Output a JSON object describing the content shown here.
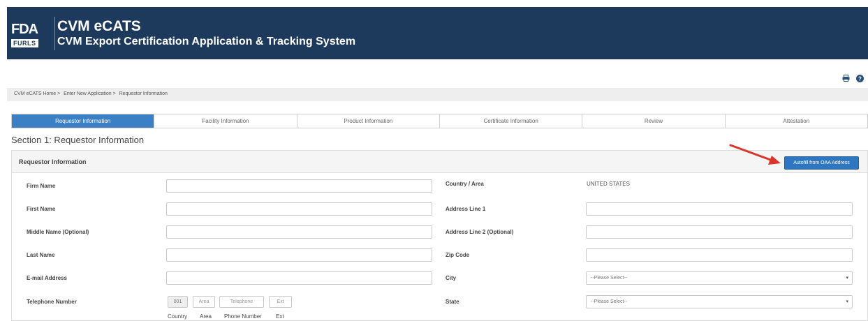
{
  "header": {
    "logo_top": "FDA",
    "logo_bottom": "FURLS",
    "title": "CVM eCATS",
    "subtitle": "CVM Export Certification Application & Tracking System"
  },
  "tools": {
    "print_icon": "print-icon",
    "help_icon": "help-icon"
  },
  "breadcrumb": [
    "CVM eCATS Home >",
    "Enter New Application >",
    "Requestor Information"
  ],
  "tabs": [
    {
      "label": "Requestor Information",
      "active": true
    },
    {
      "label": "Facility Information",
      "active": false
    },
    {
      "label": "Product Information",
      "active": false
    },
    {
      "label": "Certificate Information",
      "active": false
    },
    {
      "label": "Review",
      "active": false
    },
    {
      "label": "Attestation",
      "active": false
    }
  ],
  "section_title": "Section 1: Requestor Information",
  "panel": {
    "title": "Requestor Information",
    "autofill_label": "Autofill from OAA Address"
  },
  "left_fields": [
    {
      "label": "Firm Name",
      "value": ""
    },
    {
      "label": "First Name",
      "value": ""
    },
    {
      "label": "Middle Name (Optional)",
      "value": ""
    },
    {
      "label": "Last Name",
      "value": ""
    },
    {
      "label": "E-mail Address",
      "value": ""
    },
    {
      "label": "Telephone Number",
      "value": ""
    }
  ],
  "right_fields": {
    "country_label": "Country / Area",
    "country_value": "UNITED STATES",
    "address1_label": "Address Line 1",
    "address2_label": "Address Line 2 (Optional)",
    "zip_label": "Zip Code",
    "city_label": "City",
    "city_select": "--Please Select--",
    "state_label": "State",
    "state_select": "--Please Select--"
  },
  "phone": {
    "country_code": "001",
    "area_placeholder": "Area",
    "telephone_placeholder": "Telephone",
    "ext_placeholder": "Ext",
    "labels": [
      "Country",
      "Area",
      "Phone Number",
      "Ext"
    ]
  },
  "colors": {
    "header_bg": "#1d3a5c",
    "accent": "#3b7fc4",
    "arrow": "#d9352b"
  }
}
